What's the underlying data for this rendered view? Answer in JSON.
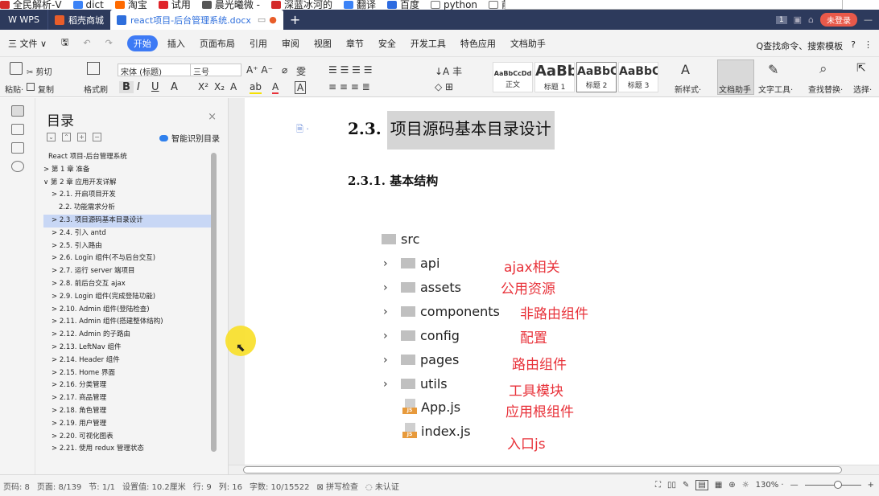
{
  "bookmarks": [
    {
      "label": "全民解析-V",
      "color": "#d42a2a"
    },
    {
      "label": "dict",
      "color": "#3b82f6"
    },
    {
      "label": "淘宝",
      "color": "#ff6a00"
    },
    {
      "label": "试用",
      "color": "#e0242a"
    },
    {
      "label": "晨光曦微 -",
      "color": "#555555"
    },
    {
      "label": "深蓝冰河的",
      "color": "#d42a2a"
    },
    {
      "label": "翻译",
      "color": "#3b82f6"
    },
    {
      "label": "百度",
      "color": "#2d6be0"
    },
    {
      "label": "python",
      "color": "#777777"
    },
    {
      "label": "前端",
      "color": "#777777"
    }
  ],
  "titlebar": {
    "logo": "W WPS",
    "tabs": [
      {
        "label": "稻壳商城",
        "color": "#e85d2a"
      },
      {
        "label": "react项目-后台管理系统.docx",
        "color": "#2f6fdc"
      }
    ],
    "page_count_badge": "1",
    "login": "未登录",
    "bg_color": "#2d3a5c"
  },
  "menubar": {
    "file": "三 文件 ∨",
    "start": "开始",
    "items": [
      "插入",
      "页面布局",
      "引用",
      "审阅",
      "视图",
      "章节",
      "安全",
      "开发工具",
      "特色应用",
      "文档助手"
    ],
    "search": "Q查找命令、搜索模板",
    "help": "?",
    "more": "⋮"
  },
  "ribbon": {
    "paste": "粘贴·",
    "cut": "✂ 剪切",
    "copy": "复制",
    "format_painter": "格式刷",
    "font": "宋体 (标题)",
    "size": "三号",
    "styles": [
      {
        "preview": "AaBbCcDd",
        "name": "正文"
      },
      {
        "preview": "AaBb",
        "name": "标题 1"
      },
      {
        "preview": "AaBbC",
        "name": "标题 2"
      },
      {
        "preview": "AaBbC",
        "name": "标题 3"
      }
    ],
    "new_style": "新样式·",
    "doc_helper": "文档助手",
    "text_tool": "文字工具·",
    "find_replace": "查找替换·",
    "select": "选择·"
  },
  "toc": {
    "title": "目录",
    "close": "×",
    "smart": "智能识别目录",
    "items": [
      "React 项目-后台管理系统",
      "> 第 1 章 准备",
      "∨ 第 2 章 应用开发详解",
      "> 2.1. 开启项目开发",
      "2.2. 功能需求分析",
      "> 2.3. 项目源码基本目录设计",
      "> 2.4. 引入 antd",
      "> 2.5. 引入路由",
      "> 2.6. Login 组件(不与后台交互)",
      "> 2.7. 运行 server 端项目",
      "> 2.8. 前后台交互 ajax",
      "> 2.9. Login 组件(完成登陆功能)",
      "> 2.10. Admin 组件(登陆检查)",
      "> 2.11. Admin 组件(搭建整体结构)",
      "> 2.12. Admin 的子路由",
      "> 2.13. LeftNav 组件",
      "> 2.14. Header 组件",
      "> 2.15. Home 界面",
      "> 2.16. 分类管理",
      "> 2.17. 商品管理",
      "> 2.18. 角色管理",
      "> 2.19. 用户管理",
      "> 2.20. 可视化图表",
      "> 2.21. 使用 redux 管理状态"
    ],
    "selected_index": 5
  },
  "doc": {
    "h2_num": "2.3.",
    "h2_text": "项目源码基本目录设计",
    "h3": "2.3.1.  基本结构",
    "root": "src",
    "folders": [
      {
        "name": "api",
        "note": "ajax相关"
      },
      {
        "name": "assets",
        "note": "公用资源"
      },
      {
        "name": "components",
        "note": "非路由组件"
      },
      {
        "name": "config",
        "note": "配置"
      },
      {
        "name": "pages",
        "note": "路由组件"
      },
      {
        "name": "utils",
        "note": "工具模块"
      }
    ],
    "files": [
      {
        "name": "App.js",
        "note": "应用根组件"
      },
      {
        "name": "index.js",
        "note": "入口js"
      }
    ],
    "js_label": "JS",
    "note_color": "#e8323a"
  },
  "status": {
    "page_num": "页码: 8",
    "page": "页面: 8/139",
    "section": "节: 1/1",
    "setting": "设置值: 10.2厘米",
    "row": "行: 9",
    "col": "列: 16",
    "words": "字数: 10/15522",
    "spell": "拼写检查",
    "auth": "未认证",
    "zoom": "130% ·",
    "minus": "—",
    "plus": "+"
  }
}
